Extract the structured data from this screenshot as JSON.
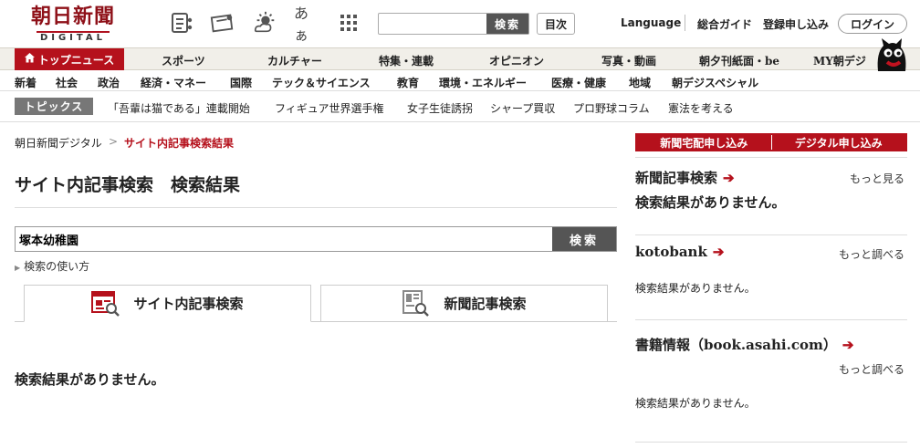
{
  "header": {
    "logo_ja": "朝日新聞",
    "logo_en": "DIGITAL",
    "search_placeholder": "",
    "search_button": "検索",
    "mokuji": "目次",
    "language": "Language",
    "guide": "総合ガイド",
    "register": "登録申し込み",
    "login": "ログイン",
    "font_size_label": "あぁ",
    "icons": [
      "newspaper-icon",
      "ticket-icon",
      "weather-icon",
      "font-size-icon",
      "grid-menu-icon"
    ]
  },
  "nav_main": {
    "top_news": "トップニュース",
    "items": [
      "スポーツ",
      "カルチャー",
      "特集・連載",
      "オピニオン",
      "写真・動画",
      "朝夕刊紙面・be",
      "MY朝デジ"
    ]
  },
  "nav_sub": {
    "items": [
      "新着",
      "社会",
      "政治",
      "経済・マネー",
      "国際",
      "テック＆サイエンス",
      "教育",
      "環境・エネルギー",
      "医療・健康",
      "地域",
      "朝デジスペシャル"
    ]
  },
  "topics": {
    "label": "トピックス",
    "items": [
      "「吾輩は猫である」連載開始",
      "フィギュア世界選手権",
      "女子生徒誘拐",
      "シャープ買収",
      "プロ野球コラム",
      "憲法を考える"
    ]
  },
  "breadcrumb": {
    "home": "朝日新聞デジタル",
    "sep": ">",
    "current": "サイト内記事検索結果"
  },
  "page_title": "サイト内記事検索　検索結果",
  "search": {
    "query": "塚本幼稚園",
    "button": "検索",
    "howto": "検索の使い方"
  },
  "tabs": [
    {
      "label": "サイト内記事検索",
      "active": true
    },
    {
      "label": "新聞記事検索",
      "active": false
    }
  ],
  "main_result": "検索結果がありません。",
  "sidebar": {
    "btn_delivery": "新聞宅配申し込み",
    "btn_digital": "デジタル申し込み",
    "sections": [
      {
        "title": "新聞記事検索",
        "more": "もっと見る",
        "result": "検索結果がありません。"
      },
      {
        "title": "kotobank",
        "more": "もっと調べる",
        "result": "検索結果がありません。"
      },
      {
        "title": "書籍情報（book.asahi.com）",
        "more": "もっと調べる",
        "result": "検索結果がありません。"
      }
    ]
  },
  "colors": {
    "brand_red": "#b5111c",
    "nav_bg": "#f1efe9",
    "button_gray": "#555555"
  }
}
